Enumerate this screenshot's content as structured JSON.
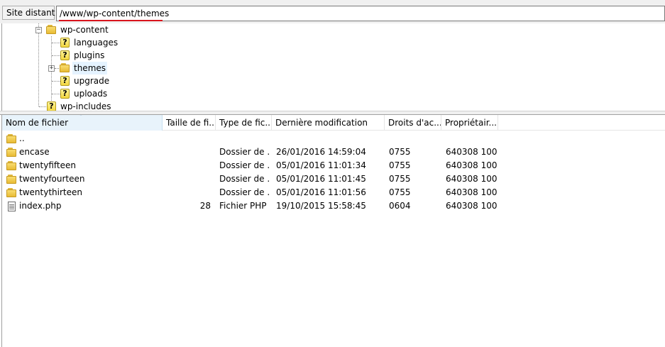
{
  "address_bar": {
    "label": "Site distant :",
    "path": "/www/wp-content/themes"
  },
  "tree": {
    "nodes": [
      {
        "label": "wp-content",
        "icon": "folder-icon",
        "expander": "−"
      },
      {
        "label": "languages",
        "icon": "unknown-icon"
      },
      {
        "label": "plugins",
        "icon": "unknown-icon"
      },
      {
        "label": "themes",
        "icon": "folder-icon",
        "expander": "+",
        "selected": true
      },
      {
        "label": "upgrade",
        "icon": "unknown-icon"
      },
      {
        "label": "uploads",
        "icon": "unknown-icon"
      },
      {
        "label": "wp-includes",
        "icon": "unknown-icon"
      }
    ]
  },
  "file_list": {
    "columns": [
      "Nom de fichier",
      "Taille de fi...",
      "Type de fic...",
      "Dernière modification",
      "Droits d'ac...",
      "Propriétair..."
    ],
    "sort_arrow": "˄",
    "rows": [
      {
        "name": "..",
        "size": "",
        "type": "",
        "modified": "",
        "perms": "",
        "owner": "",
        "icon": "folder-icon"
      },
      {
        "name": "encase",
        "size": "",
        "type": "Dossier de ...",
        "modified": "26/01/2016 14:59:04",
        "perms": "0755",
        "owner": "640308 100",
        "icon": "folder-icon"
      },
      {
        "name": "twentyfifteen",
        "size": "",
        "type": "Dossier de ...",
        "modified": "05/01/2016 11:01:34",
        "perms": "0755",
        "owner": "640308 100",
        "icon": "folder-icon"
      },
      {
        "name": "twentyfourteen",
        "size": "",
        "type": "Dossier de ...",
        "modified": "05/01/2016 11:01:45",
        "perms": "0755",
        "owner": "640308 100",
        "icon": "folder-icon"
      },
      {
        "name": "twentythirteen",
        "size": "",
        "type": "Dossier de ...",
        "modified": "05/01/2016 11:01:56",
        "perms": "0755",
        "owner": "640308 100",
        "icon": "folder-icon"
      },
      {
        "name": "index.php",
        "size": "28",
        "type": "Fichier PHP",
        "modified": "19/10/2015 15:58:45",
        "perms": "0604",
        "owner": "640308 100",
        "icon": "file-icon"
      }
    ]
  }
}
